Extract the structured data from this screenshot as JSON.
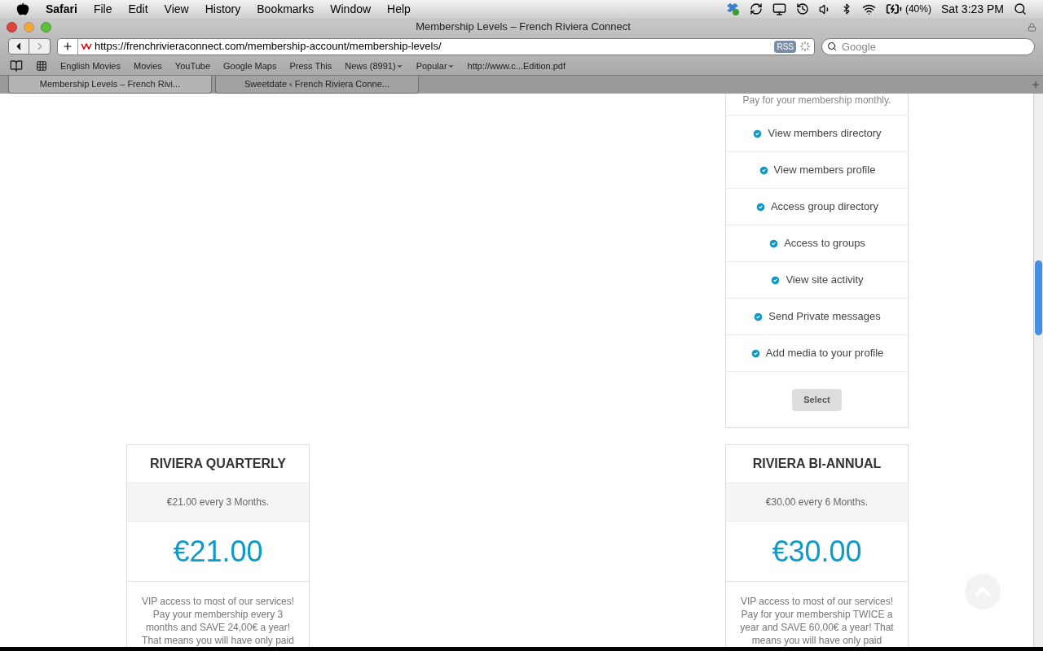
{
  "menu_bar": {
    "app": "Safari",
    "items": [
      "File",
      "Edit",
      "View",
      "History",
      "Bookmarks",
      "Window",
      "Help"
    ],
    "battery": "(40%)",
    "clock": "Sat 3:23 PM"
  },
  "window": {
    "title": "Membership Levels – French Riviera Connect"
  },
  "toolbar": {
    "url": "https://frenchrivieraconnect.com/membership-account/membership-levels/",
    "rss": "RSS",
    "search_placeholder": "Google"
  },
  "bookmarks": [
    {
      "label": "English Movies",
      "menu": false
    },
    {
      "label": "Movies",
      "menu": false
    },
    {
      "label": "YouTube",
      "menu": false
    },
    {
      "label": "Google Maps",
      "menu": false
    },
    {
      "label": "Press This",
      "menu": false
    },
    {
      "label": "News (8991)",
      "menu": true
    },
    {
      "label": "Popular",
      "menu": true
    },
    {
      "label": "http://www.c...Edition.pdf",
      "menu": false
    }
  ],
  "tabs": [
    {
      "label": "Membership Levels – French Rivi...",
      "selected": true
    },
    {
      "label": "Sweetdate ‹ French Riviera Conne...",
      "selected": false
    }
  ],
  "monthly_card": {
    "description": "Pay for your membership monthly.",
    "features": [
      "View members directory",
      "View members profile",
      "Access group directory",
      "Access to groups",
      "View site activity",
      "Send Private messages",
      "Add media to your profile"
    ],
    "button": "Select"
  },
  "plans": [
    {
      "title": "RIVIERA QUARTERLY",
      "billing": "€21.00 every 3 Months.",
      "price": "€21.00",
      "description": "VIP access to most of our services! Pay your membership every 3 months and SAVE 24,00€ a year! That means you will have only paid"
    },
    {
      "title": "RIVIERA BI-ANNUAL",
      "billing": "€30.00 every 6 Months.",
      "price": "€30.00",
      "description": "VIP access to most of our services! Pay for your membership TWICE a year and SAVE 60,00€ a year! That means you will have only paid"
    }
  ]
}
